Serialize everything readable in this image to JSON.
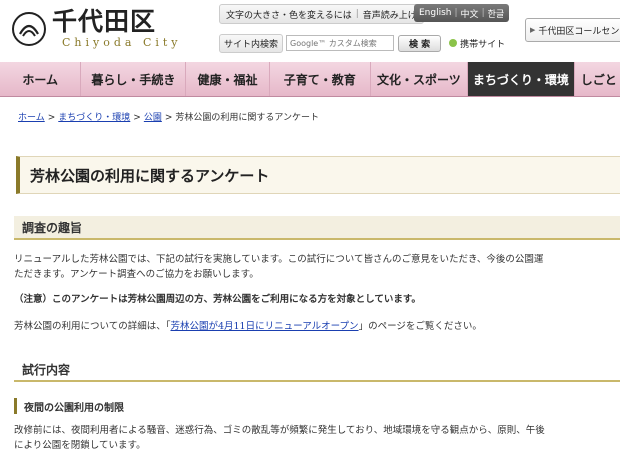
{
  "header": {
    "logo_title": "千代田区",
    "logo_subtitle": "Chiyoda City",
    "util_links": [
      "文字の大きさ・色を変えるには",
      "音声読み上げ"
    ],
    "lang_links": [
      "English",
      "中文",
      "한글"
    ],
    "search_label": "サイト内検索",
    "search_placeholder": "Google™ カスタム検索",
    "search_button": "検 索",
    "mobile_link": "携帯サイト",
    "callcenter": "千代田区コールセンター"
  },
  "nav": {
    "items": [
      {
        "label": "ホーム"
      },
      {
        "label": "暮らし・手続き"
      },
      {
        "label": "健康・福祉"
      },
      {
        "label": "子育て・教育"
      },
      {
        "label": "文化・スポーツ"
      },
      {
        "label": "まちづくり・環境"
      },
      {
        "label": "しごと"
      }
    ],
    "active_index": 5
  },
  "breadcrumb": {
    "links": [
      "ホーム",
      "まちづくり・環境",
      "公園"
    ],
    "separator": ">",
    "current": "芳林公園の利用に関するアンケート"
  },
  "page_title": "芳林公園の利用に関するアンケート",
  "sections": {
    "purpose_heading": "調査の趣旨",
    "purpose_line1": "リニューアルした芳林公園では、下記の試行を実施しています。この試行について皆さんのご意見をいただき、今後の公園運",
    "purpose_line2": "ただきます。アンケート調査へのご協力をお願いします。",
    "notice": "（注意）このアンケートは芳林公園周辺の方、芳林公園をご利用になる方を対象としています。",
    "detail_prefix": "芳林公園の利用についての詳細は、「",
    "detail_link": "芳林公園が4月11日にリニューアルオープン",
    "detail_suffix": "」のページをご覧ください。",
    "trial_heading": "試行内容",
    "night_heading": "夜間の公園利用の制限",
    "night_line1": "改修前には、夜間利用者による騒音、迷惑行為、ゴミの散乱等が頻繁に発生しており、地域環境を守る観点から、原則、午後",
    "night_line2": "により公園を閉鎖しています。"
  },
  "colors": {
    "nav_bg": "#e6b8c9",
    "nav_active": "#333333",
    "accent": "#8a7a2a",
    "link": "#1a3fb0"
  }
}
